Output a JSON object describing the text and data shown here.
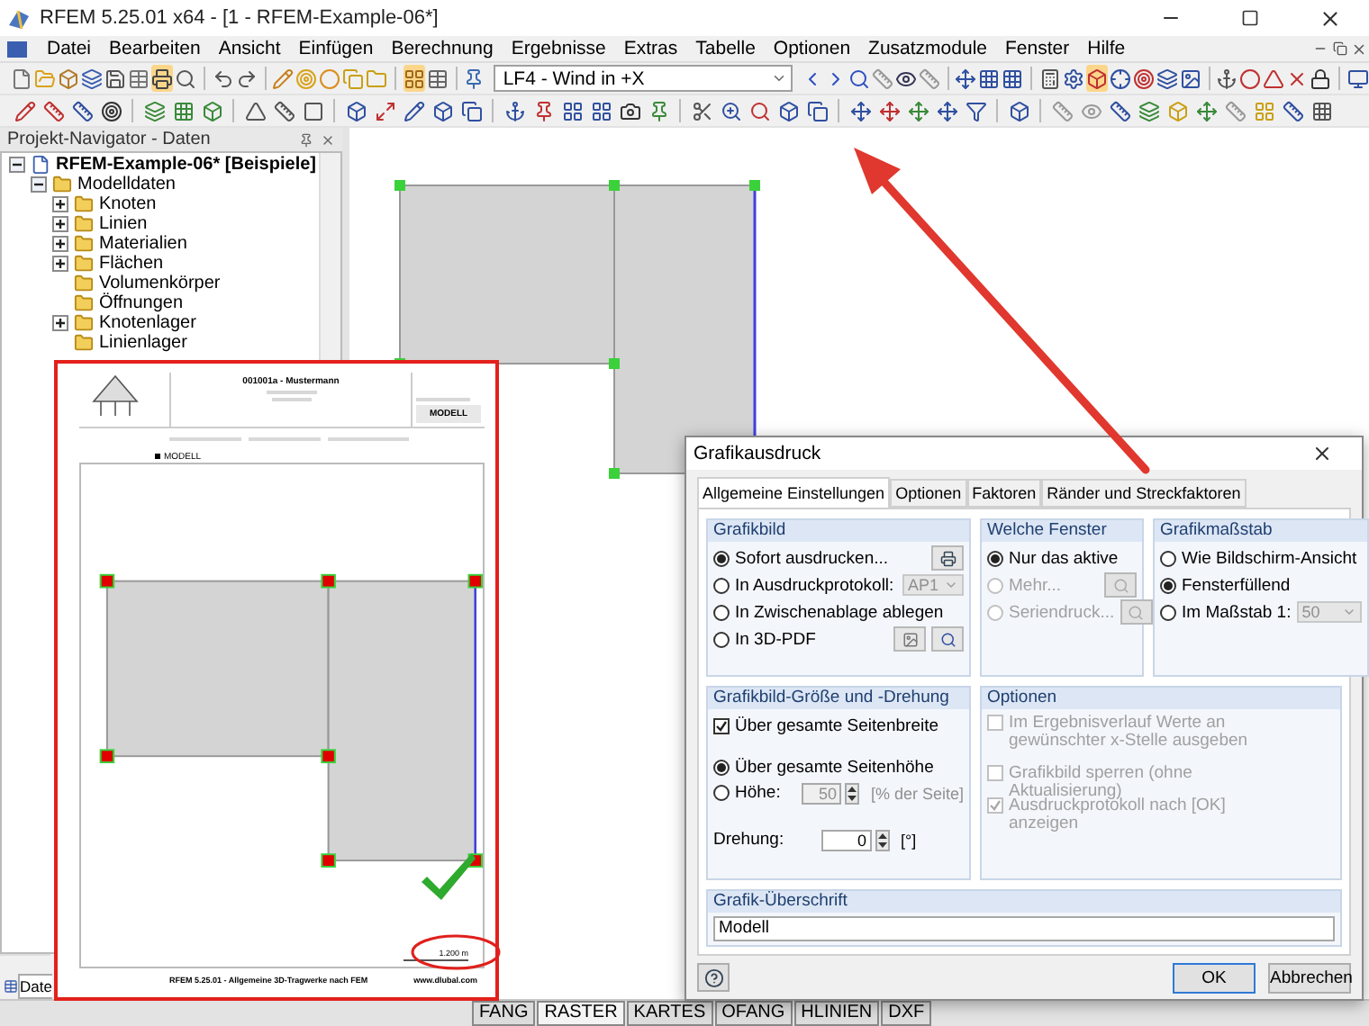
{
  "window": {
    "title": "RFEM 5.25.01 x64 - [1 - RFEM-Example-06*]"
  },
  "menu": [
    "Datei",
    "Bearbeiten",
    "Ansicht",
    "Einfügen",
    "Berechnung",
    "Ergebnisse",
    "Extras",
    "Tabelle",
    "Optionen",
    "Zusatzmodule",
    "Fenster",
    "Hilfe"
  ],
  "toolbar": {
    "load_case": "LF4 - Wind in +X"
  },
  "navigator": {
    "title": "Projekt-Navigator - Daten",
    "bottom_tab": "Date",
    "tree": [
      {
        "label": "RFEM-Example-06* [Beispiele]",
        "kind": "project",
        "expanded": true,
        "children": [
          {
            "label": "Modelldaten",
            "kind": "folder",
            "expanded": true,
            "children": [
              {
                "label": "Knoten",
                "kind": "folder",
                "expanded": false
              },
              {
                "label": "Linien",
                "kind": "folder",
                "expanded": false
              },
              {
                "label": "Materialien",
                "kind": "folder",
                "expanded": false
              },
              {
                "label": "Flächen",
                "kind": "folder",
                "expanded": false
              },
              {
                "label": "Volumenkörper",
                "kind": "folder"
              },
              {
                "label": "Öffnungen",
                "kind": "folder"
              },
              {
                "label": "Knotenlager",
                "kind": "folder",
                "expanded": false
              },
              {
                "label": "Linienlager",
                "kind": "folder"
              }
            ]
          }
        ]
      }
    ]
  },
  "print_preview": {
    "header_title": "001001a - Mustermann",
    "header_badge": "MODELL",
    "section": "MODELL",
    "scale": "1.200 m",
    "footer": "RFEM 5.25.01 - Allgemeine 3D-Tragwerke nach FEM",
    "website": "www.dlubal.com"
  },
  "dialog": {
    "title": "Grafikausdruck",
    "tabs": [
      {
        "label": "Allgemeine Einstellungen",
        "selected": true
      },
      {
        "label": "Optionen",
        "selected": false
      },
      {
        "label": "Faktoren",
        "selected": false
      },
      {
        "label": "Ränder und Streckfaktoren",
        "selected": false
      }
    ],
    "grafikbild": {
      "title": "Grafikbild",
      "options": [
        {
          "label": "Sofort ausdrucken...",
          "selected": true,
          "disabled": false,
          "kind": "button"
        },
        {
          "label": "In Ausdruckprotokoll:",
          "selected": false,
          "disabled": false,
          "kind": "select",
          "value": "AP1"
        },
        {
          "label": "In Zwischenablage ablegen",
          "selected": false,
          "disabled": false,
          "kind": "plain"
        },
        {
          "label": "In 3D-PDF",
          "selected": false,
          "disabled": false,
          "kind": "buttons"
        }
      ]
    },
    "fenster": {
      "title": "Welche Fenster",
      "options": [
        {
          "label": "Nur das aktive",
          "selected": true,
          "disabled": false,
          "kind": "plain"
        },
        {
          "label": "Mehr...",
          "selected": false,
          "disabled": true,
          "kind": "button"
        },
        {
          "label": "Seriendruck...",
          "selected": false,
          "disabled": true,
          "kind": "button"
        }
      ]
    },
    "massstab": {
      "title": "Grafikmaßstab",
      "options": [
        {
          "label": "Wie Bildschirm-Ansicht",
          "selected": false,
          "disabled": false,
          "kind": "plain"
        },
        {
          "label": "Fensterfüllend",
          "selected": true,
          "disabled": false,
          "kind": "plain"
        },
        {
          "label": "Im Maßstab 1:",
          "selected": false,
          "disabled": false,
          "kind": "select",
          "value": "50"
        }
      ]
    },
    "size": {
      "title": "Grafikbild-Größe und -Drehung",
      "width_check": {
        "label": "Über gesamte Seitenbreite",
        "checked": true
      },
      "height_options": [
        {
          "label": "Über gesamte Seitenhöhe",
          "selected": true
        },
        {
          "label": "Höhe:",
          "selected": false,
          "value": "50",
          "unit": "[% der Seite]",
          "disabled": true
        }
      ],
      "rotation": {
        "label": "Drehung:",
        "value": "0",
        "unit": "[°]"
      }
    },
    "options": {
      "title": "Optionen",
      "items": [
        {
          "label": "Im Ergebnisverlauf Werte an gewünschter x-Stelle ausgeben",
          "checked": false,
          "disabled": true
        },
        {
          "label": "Grafikbild sperren (ohne Aktualisierung)",
          "checked": false,
          "disabled": true
        },
        {
          "label": "Ausdruckprotokoll nach [OK] anzeigen",
          "checked": true,
          "disabled": true
        }
      ]
    },
    "caption": {
      "title": "Grafik-Überschrift",
      "value": "Modell"
    },
    "buttons": [
      {
        "label": "OK",
        "kind": "primary"
      },
      {
        "label": "Abbrechen",
        "kind": "normal"
      }
    ]
  },
  "status_bar": [
    {
      "label": "FANG",
      "selected": false
    },
    {
      "label": "RASTER",
      "selected": true
    },
    {
      "label": "KARTES",
      "selected": false
    },
    {
      "label": "OFANG",
      "selected": false
    },
    {
      "label": "HLINIEN",
      "selected": false
    },
    {
      "label": "DXF",
      "selected": false
    }
  ]
}
